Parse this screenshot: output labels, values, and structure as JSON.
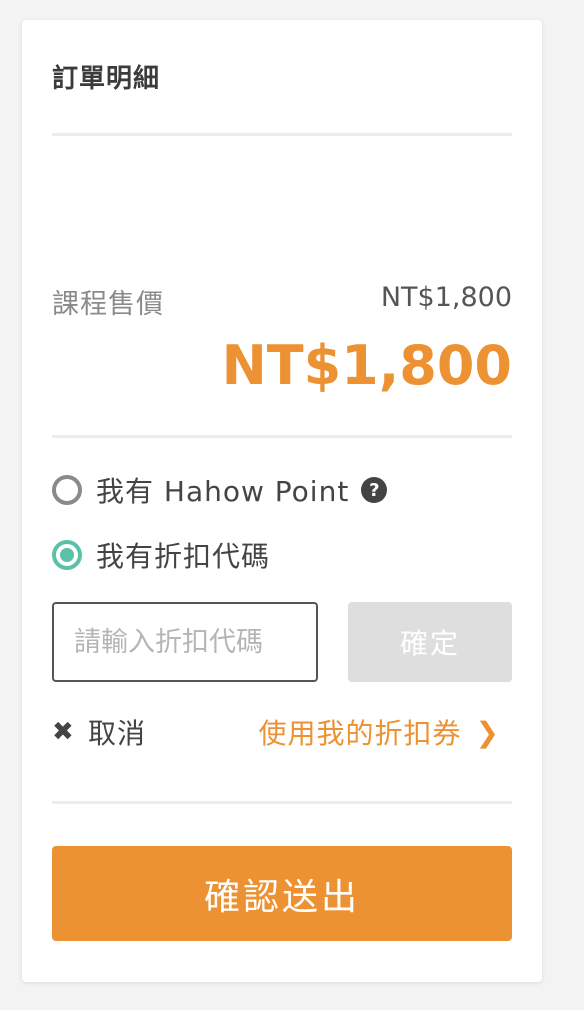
{
  "order": {
    "title": "訂單明細",
    "price_label": "課程售價",
    "price_value": "NT$1,800",
    "total": "NT$1,800"
  },
  "discount": {
    "options": [
      {
        "label": "我有 Hahow Point",
        "selected": false
      },
      {
        "label": "我有折扣代碼",
        "selected": true
      }
    ],
    "help_icon": "?",
    "code_placeholder": "請輸入折扣代碼",
    "code_value": "",
    "confirm_label": "確定",
    "cancel_icon": "✖",
    "cancel_label": "取消",
    "coupon_link": "使用我的折扣券",
    "chevron_icon": "❯"
  },
  "submit_label": "確認送出",
  "colors": {
    "accent": "#ec9233",
    "radio_selected": "#5bc0a8",
    "disabled_button": "#dedede"
  }
}
